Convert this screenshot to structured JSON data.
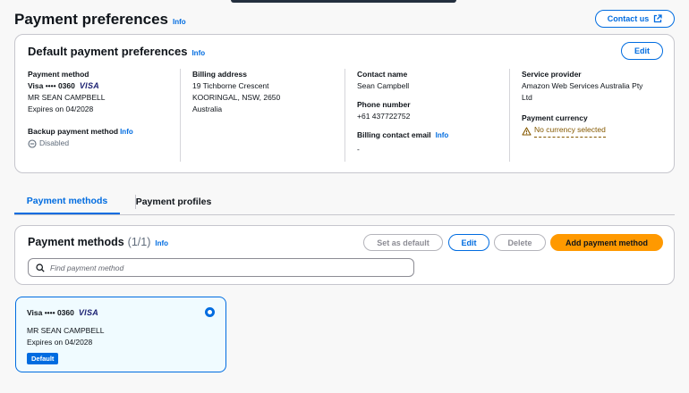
{
  "header": {
    "title": "Payment preferences",
    "info": "Info",
    "contact_label": "Contact us"
  },
  "defaults": {
    "title": "Default payment preferences",
    "info": "Info",
    "edit_label": "Edit",
    "payment_method": {
      "label": "Payment method",
      "card": "Visa •••• 0360",
      "brand": "VISA",
      "holder": "MR SEAN CAMPBELL",
      "expires": "Expires on 04/2028"
    },
    "backup": {
      "label": "Backup payment method",
      "info": "Info",
      "status": "Disabled"
    },
    "billing_address": {
      "label": "Billing address",
      "line1": "19 Tichborne Crescent",
      "line2": "KOORINGAL, NSW, 2650",
      "line3": "Australia"
    },
    "contact": {
      "name_label": "Contact name",
      "name": "Sean Campbell",
      "phone_label": "Phone number",
      "phone": "+61 437722752",
      "email_label": "Billing contact email",
      "email_info": "Info",
      "email": "-"
    },
    "provider": {
      "label": "Service provider",
      "line1": "Amazon Web Services Australia Pty",
      "line2": "Ltd",
      "currency_label": "Payment currency",
      "currency_value": "No currency selected"
    }
  },
  "tabs": [
    {
      "label": "Payment methods",
      "active": true
    },
    {
      "label": "Payment profiles",
      "active": false
    }
  ],
  "methods": {
    "title": "Payment methods",
    "count": "(1/1)",
    "info": "Info",
    "set_default_label": "Set as default",
    "edit_label": "Edit",
    "delete_label": "Delete",
    "add_label": "Add payment method",
    "search_placeholder": "Find payment method"
  },
  "card": {
    "name": "Visa •••• 0360",
    "brand": "VISA",
    "holder": "MR SEAN CAMPBELL",
    "expires": "Expires on 04/2028",
    "badge": "Default",
    "selected": true
  },
  "colors": {
    "accent": "#006ce0",
    "primary_button": "#ff9900",
    "warning": "#855900"
  },
  "icons": [
    "external-link-icon",
    "disabled-circle-icon",
    "warning-icon",
    "search-icon"
  ]
}
